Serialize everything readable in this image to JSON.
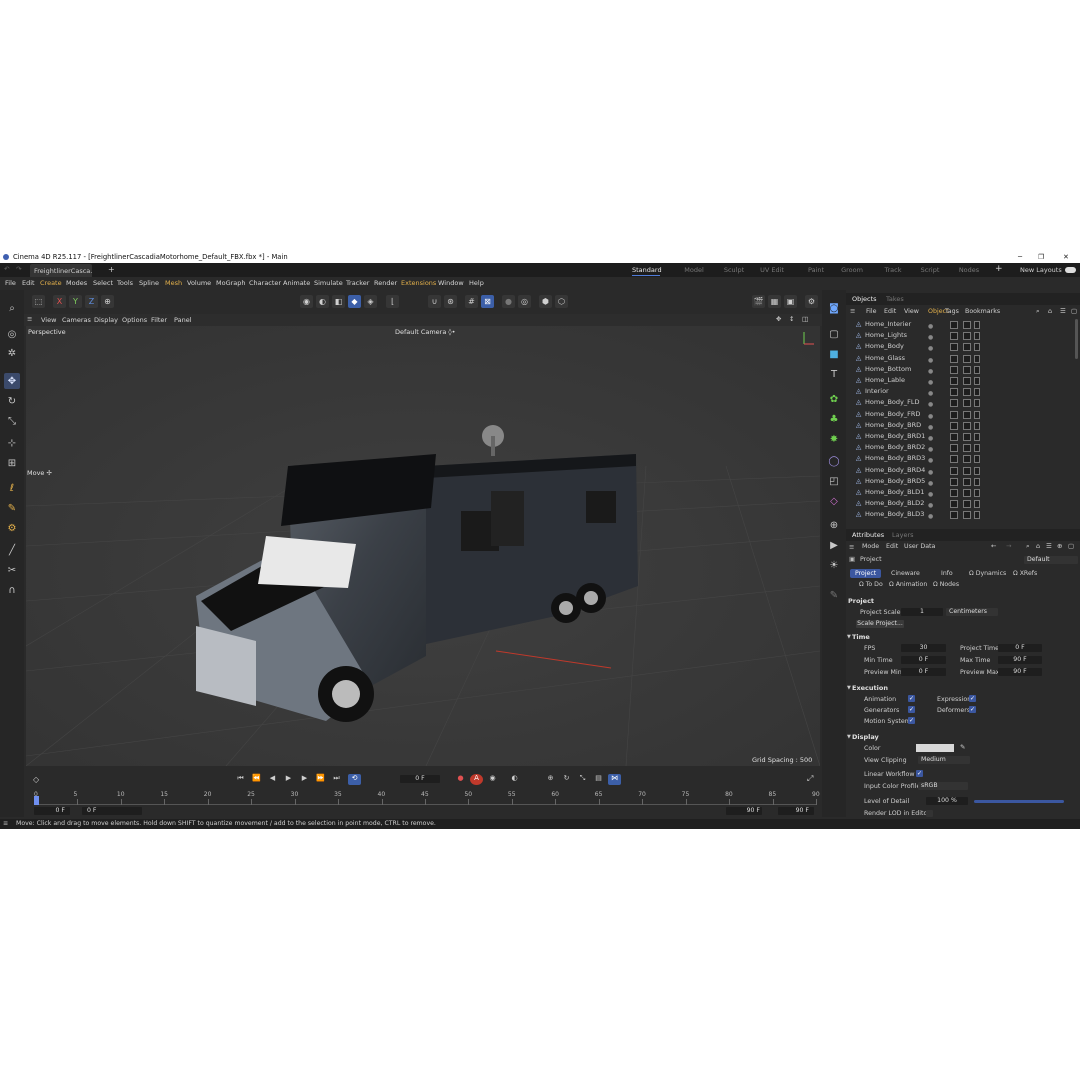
{
  "window": {
    "title": "Cinema 4D R25.117 - [FreightlinerCascadiaMotorhome_Default_FBX.fbx *] - Main",
    "minimize": "─",
    "maximize": "❐",
    "close": "✕"
  },
  "doc_tab": "FreightlinerCasca...",
  "add_tab": "+",
  "layouts": [
    "Standard",
    "Model",
    "Sculpt",
    "UV Edit",
    "Paint",
    "Groom",
    "Track",
    "Script",
    "Nodes"
  ],
  "new_layouts": "New Layouts",
  "menus": [
    "File",
    "Edit",
    "Create",
    "Modes",
    "Select",
    "Tools",
    "Spline",
    "Mesh",
    "Volume",
    "MoGraph",
    "Character",
    "Animate",
    "Simulate",
    "Tracker",
    "Render",
    "Extensions",
    "Window",
    "Help"
  ],
  "coord_toggles": [
    "X",
    "Y",
    "Z"
  ],
  "viewport": {
    "menu": [
      "View",
      "Cameras",
      "Display",
      "Options",
      "Filter",
      "Panel"
    ],
    "label": "Perspective",
    "camera": "Default Camera ◊•",
    "move_label": "Move ✢",
    "grid_spacing": "Grid Spacing : 500 cm"
  },
  "timeline": {
    "current_frame": "0 F",
    "ruler": [
      "0",
      "5",
      "10",
      "15",
      "20",
      "25",
      "30",
      "35",
      "40",
      "45",
      "50",
      "55",
      "60",
      "65",
      "70",
      "75",
      "80",
      "85",
      "90"
    ],
    "start": "0 F",
    "start2": "0 F",
    "end": "90 F",
    "end2": "90 F"
  },
  "status": "Move: Click and drag to move elements. Hold down SHIFT to quantize movement / add to the selection in point mode, CTRL to remove.",
  "objects": {
    "tabs": [
      "Objects",
      "Takes"
    ],
    "menu": [
      "File",
      "Edit",
      "View",
      "Object",
      "Tags",
      "Bookmarks"
    ],
    "items": [
      "Home_Interier",
      "Home_Lights",
      "Home_Body",
      "Home_Glass",
      "Home_Bottom",
      "Home_Lable",
      "Interior",
      "Home_Body_FLD",
      "Home_Body_FRD",
      "Home_Body_BRD",
      "Home_Body_BRD1",
      "Home_Body_BRD2",
      "Home_Body_BRD3",
      "Home_Body_BRD4",
      "Home_Body_BRD5",
      "Home_Body_BLD1",
      "Home_Body_BLD2",
      "Home_Body_BLD3"
    ]
  },
  "attributes": {
    "tabs": [
      "Attributes",
      "Layers"
    ],
    "menu": [
      "Mode",
      "Edit",
      "User Data"
    ],
    "object": "Project",
    "preset": "Default",
    "tabs1": [
      "Project",
      "Cineware",
      "Info",
      "Ω Dynamics",
      "Ω XRefs"
    ],
    "tabs2": [
      "Ω To Do",
      "Ω Animation",
      "Ω Nodes"
    ],
    "section": "Project",
    "scale_label": "Project Scale",
    "scale_value": "1",
    "scale_unit": "Centimeters",
    "scale_button": "Scale Project...",
    "time": {
      "header": "Time",
      "fps_l": "FPS",
      "fps": "30",
      "ptime_l": "Project Time",
      "ptime": "0 F",
      "min_l": "Min Time",
      "min": "0 F",
      "max_l": "Max Time",
      "max": "90 F",
      "pmin_l": "Preview Min",
      "pmin": "0 F",
      "pmax_l": "Preview Max",
      "pmax": "90 F"
    },
    "exec": {
      "header": "Execution",
      "animation": "Animation",
      "expression": "Expression",
      "generators": "Generators",
      "deformers": "Deformers",
      "motion": "Motion System"
    },
    "display": {
      "header": "Display",
      "color": "Color",
      "clipping": "View Clipping",
      "clipping_v": "Medium",
      "linear": "Linear Workflow",
      "profile": "Input Color Profile",
      "profile_v": "sRGB",
      "lod": "Level of Detail",
      "lod_v": "100 %",
      "render_lod": "Render LOD in Editor"
    }
  },
  "colors": {
    "accent": "#3b57a0",
    "highlight": "#e3b04b"
  }
}
